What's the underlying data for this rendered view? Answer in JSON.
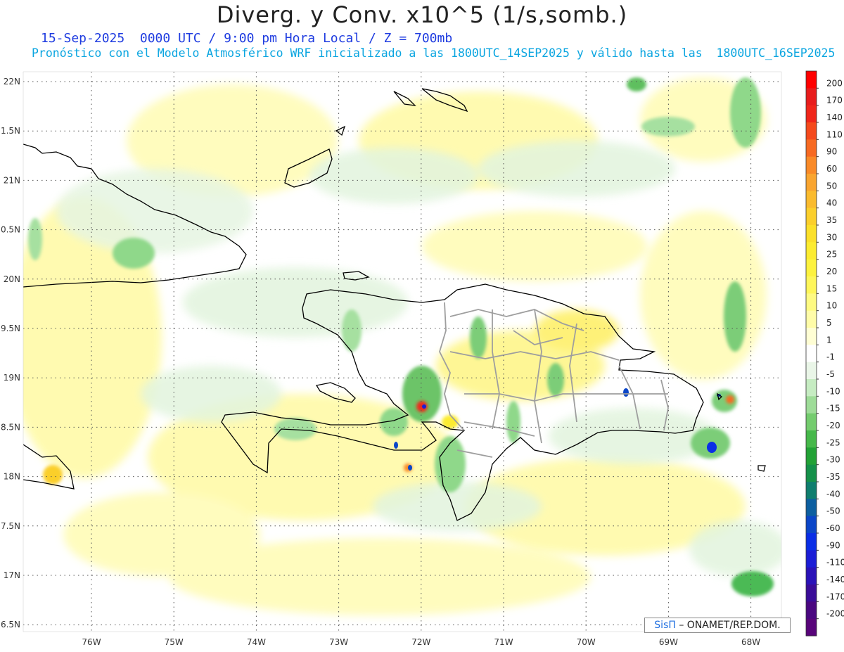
{
  "header": {
    "title": "Diverg. y Conv. x10^5 (1/s,somb.)",
    "subtitle": "15-Sep-2025  0000 UTC / 9:00 pm Hora Local / Z = 700mb",
    "validity": "Pronóstico con el Modelo Atmosférico WRF inicializado a las 1800UTC_14SEP2025 y válido hasta las  1800UTC_16SEP2025"
  },
  "map": {
    "lon_range": [
      -76.6,
      -67.6
    ],
    "lat_range": [
      16.4,
      22.1
    ],
    "lon_ticks": [
      "76W",
      "75W",
      "74W",
      "73W",
      "72W",
      "71W",
      "70W",
      "69W",
      "68W"
    ],
    "lat_ticks": [
      "22N",
      "1.5N",
      "21N",
      "0.5N",
      "20N",
      "9.5N",
      "19N",
      "8.5N",
      "18N",
      "7.5N",
      "17N",
      "6.5N"
    ],
    "grid": "dotted"
  },
  "colorbar": {
    "labels": [
      "200",
      "170",
      "140",
      "110",
      "90",
      "60",
      "50",
      "40",
      "35",
      "30",
      "25",
      "20",
      "15",
      "10",
      "5",
      "1",
      "-1",
      "-5",
      "-10",
      "-15",
      "-20",
      "-25",
      "-30",
      "-35",
      "-40",
      "-50",
      "-60",
      "-90",
      "-110",
      "-140",
      "-170",
      "-200"
    ],
    "colors": [
      "#ff0000",
      "#e81c1c",
      "#f0261a",
      "#f54a1c",
      "#f76a22",
      "#f98a28",
      "#f9a530",
      "#fabb2e",
      "#fbcf2c",
      "#fbe02a",
      "#fcec30",
      "#fdf23e",
      "#fef65a",
      "#fefa82",
      "#fffca8",
      "#fffed4",
      "#ffffff",
      "#eaf6e8",
      "#c6ecc2",
      "#9edc98",
      "#74cc6e",
      "#46b84a",
      "#22a236",
      "#15914a",
      "#0f7e6e",
      "#0d5fa0",
      "#0b46c8",
      "#0a2ee6",
      "#1b1dd6",
      "#2a12b8",
      "#3a0c98",
      "#4a0780",
      "#58047a"
    ]
  },
  "credit": {
    "logo": "SisΠ",
    "text": "– ONAMET/REP.DOM."
  }
}
